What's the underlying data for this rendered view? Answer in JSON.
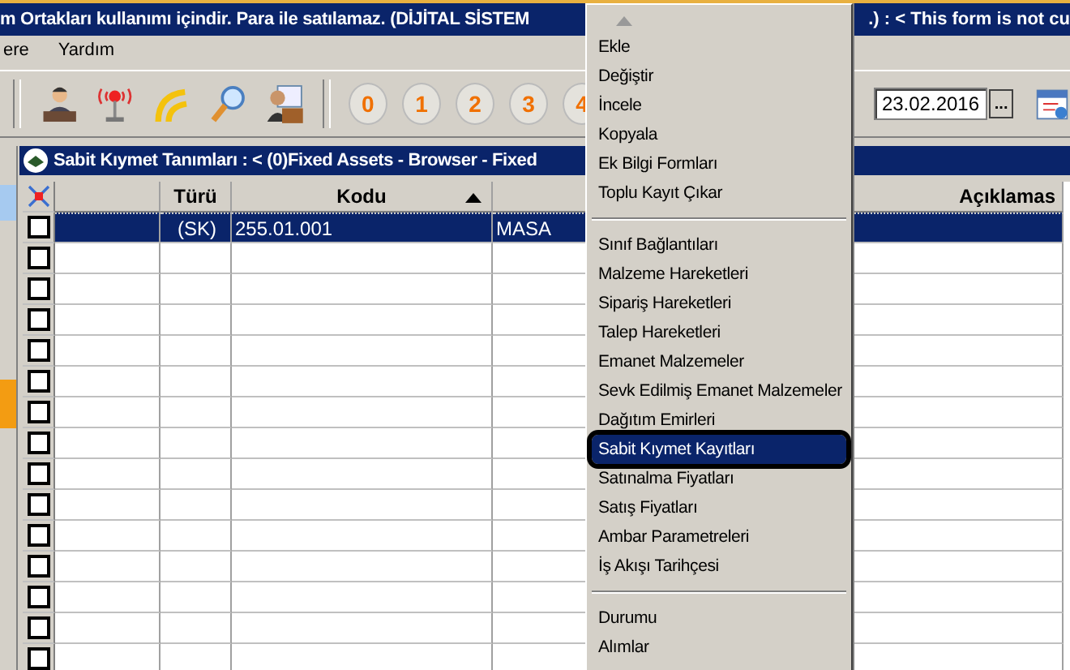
{
  "window": {
    "title_left": "m Ortakları kullanımı içindir. Para ile satılamaz. (DİJİTAL SİSTEM",
    "title_right": ".) : < This form is not cu"
  },
  "menubar": [
    "ere",
    "Yardım"
  ],
  "toolbar": {
    "number_buttons": [
      "0",
      "1",
      "2",
      "3",
      "4"
    ],
    "date": "23.02.2016",
    "date_button": "..."
  },
  "subwindow": {
    "title": "Sabit Kıymet Tanımları : < (0)Fixed Assets - Browser - Fixed"
  },
  "table": {
    "columns": [
      {},
      {
        "label": "Türü"
      },
      {
        "label": "Kodu",
        "sorted": true
      },
      {},
      {
        "label": "Açıklamas"
      }
    ],
    "rows": [
      {
        "checked": false,
        "selected": true,
        "cells": [
          "",
          "(SK)",
          "255.01.001",
          "MASA",
          ""
        ]
      },
      {
        "checked": false,
        "selected": false
      },
      {
        "checked": false,
        "selected": false
      },
      {
        "checked": false,
        "selected": false
      },
      {
        "checked": false,
        "selected": false
      },
      {
        "checked": false,
        "selected": false
      },
      {
        "checked": false,
        "selected": false
      },
      {
        "checked": false,
        "selected": false
      },
      {
        "checked": false,
        "selected": false
      },
      {
        "checked": false,
        "selected": false
      },
      {
        "checked": false,
        "selected": false
      },
      {
        "checked": false,
        "selected": false
      },
      {
        "checked": false,
        "selected": false
      },
      {
        "checked": false,
        "selected": false
      },
      {
        "checked": false,
        "selected": false
      }
    ]
  },
  "context_menu": {
    "items": [
      {
        "kind": "item",
        "label": "Ekle",
        "selected": false
      },
      {
        "kind": "item",
        "label": "Değiştir",
        "selected": false
      },
      {
        "kind": "item",
        "label": "İncele",
        "selected": false
      },
      {
        "kind": "item",
        "label": "Kopyala",
        "selected": false
      },
      {
        "kind": "item",
        "label": "Ek Bilgi Formları",
        "selected": false
      },
      {
        "kind": "item",
        "label": "Toplu Kayıt Çıkar",
        "selected": false
      },
      {
        "kind": "separator"
      },
      {
        "kind": "item",
        "label": "Sınıf Bağlantıları",
        "selected": false
      },
      {
        "kind": "item",
        "label": "Malzeme Hareketleri",
        "selected": false
      },
      {
        "kind": "item",
        "label": "Sipariş Hareketleri",
        "selected": false
      },
      {
        "kind": "item",
        "label": "Talep Hareketleri",
        "selected": false
      },
      {
        "kind": "item",
        "label": "Emanet Malzemeler",
        "selected": false
      },
      {
        "kind": "item",
        "label": "Sevk Edilmiş Emanet Malzemeler",
        "selected": false
      },
      {
        "kind": "item",
        "label": "Dağıtım Emirleri",
        "selected": false
      },
      {
        "kind": "item",
        "label": "Sabit Kıymet Kayıtları",
        "selected": true
      },
      {
        "kind": "item",
        "label": "Satınalma Fiyatları",
        "selected": false
      },
      {
        "kind": "item",
        "label": "Satış Fiyatları",
        "selected": false
      },
      {
        "kind": "item",
        "label": "Ambar Parametreleri",
        "selected": false
      },
      {
        "kind": "item",
        "label": "İş Akışı Tarihçesi",
        "selected": false
      },
      {
        "kind": "separator"
      },
      {
        "kind": "item",
        "label": "Durumu",
        "selected": false
      },
      {
        "kind": "item",
        "label": "Alımlar",
        "selected": false
      }
    ]
  }
}
